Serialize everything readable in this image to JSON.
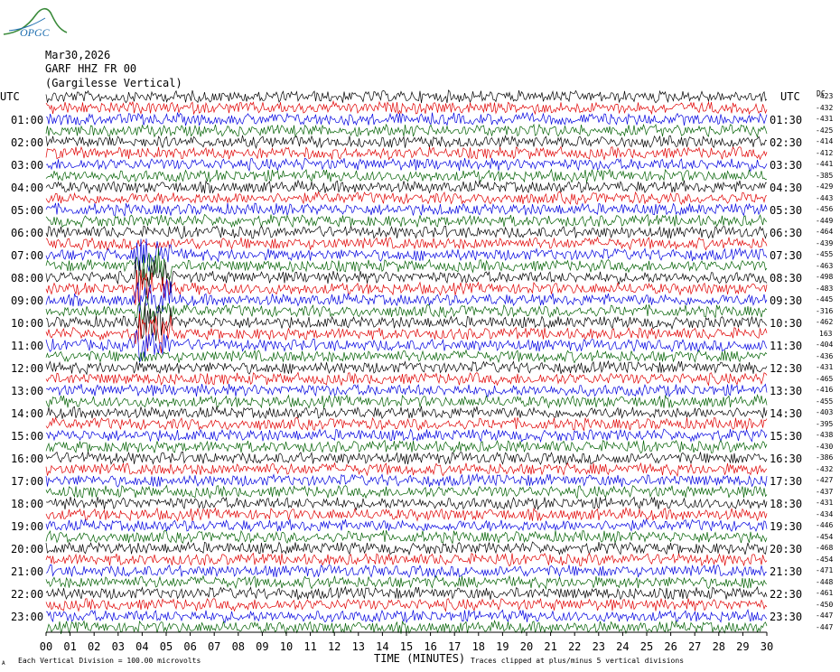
{
  "logo": {
    "text": "OPGC",
    "color": "#1f6fb0",
    "accent": "#3a8a3a"
  },
  "header": {
    "date": "Mar30,2026",
    "station": "GARF HHZ FR 00",
    "location": "(Gargilesse Vertical)"
  },
  "axis": {
    "left_label": "UTC",
    "right_label": "UTC",
    "right_corner": "DC",
    "xlabel": "TIME (MINUTES)",
    "footer_left": "Each Vertical Division =  100.00 microvolts",
    "footer_right": "Traces clipped at plus/minus 5 vertical divisions",
    "footer_mark": "A"
  },
  "chart_data": {
    "type": "line",
    "title": "",
    "x_range": [
      0,
      30
    ],
    "x_ticks": [
      "00",
      "01",
      "02",
      "03",
      "04",
      "05",
      "06",
      "07",
      "08",
      "09",
      "10",
      "11",
      "12",
      "13",
      "14",
      "15",
      "16",
      "17",
      "18",
      "19",
      "20",
      "21",
      "22",
      "23",
      "24",
      "25",
      "26",
      "27",
      "28",
      "29",
      "30"
    ],
    "trace_colors": [
      "#000000",
      "#e00000",
      "#0000e0",
      "#006000"
    ],
    "left_time_labels": [
      "01:00",
      "02:00",
      "03:00",
      "04:00",
      "05:00",
      "06:00",
      "07:00",
      "08:00",
      "09:00",
      "10:00",
      "11:00",
      "12:00",
      "13:00",
      "14:00",
      "15:00",
      "16:00",
      "17:00",
      "18:00",
      "19:00",
      "20:00",
      "21:00",
      "22:00",
      "23:00"
    ],
    "right_time_labels": [
      "01:30",
      "02:30",
      "03:30",
      "04:30",
      "05:30",
      "06:30",
      "07:30",
      "08:30",
      "09:30",
      "10:30",
      "11:30",
      "12:30",
      "13:30",
      "14:30",
      "15:30",
      "16:30",
      "17:30",
      "18:30",
      "19:30",
      "20:30",
      "21:30",
      "22:30",
      "23:30"
    ],
    "dc_offsets": [
      "-423",
      "-432",
      "-431",
      "-425",
      "-414",
      "-412",
      "-441",
      "-385",
      "-429",
      "-443",
      "-456",
      "-449",
      "-464",
      "-439",
      "-455",
      "-463",
      "-498",
      "-483",
      "-445",
      "-316",
      "-462",
      "163",
      "-404",
      "-436",
      "-431",
      "-465",
      "-416",
      "-455",
      "-403",
      "-395",
      "-438",
      "-430",
      "-386",
      "-432",
      "-427",
      "-437",
      "-431",
      "-434",
      "-446",
      "-454",
      "-468",
      "-454",
      "-471",
      "-448",
      "-461",
      "-450",
      "-447",
      "-447"
    ],
    "events": [
      {
        "start_trace": 14,
        "end_trace": 22,
        "minute_start": 3.7,
        "minute_end": 5.2,
        "description": "large amplitude burst"
      }
    ]
  }
}
